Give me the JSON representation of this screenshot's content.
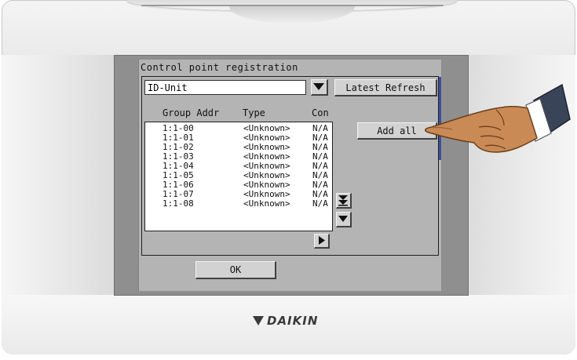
{
  "dialog": {
    "title": "Control point registration",
    "combo_value": "ID-Unit",
    "latest_refresh_label": "Latest Refresh",
    "add_all_label": "Add all",
    "ok_label": "OK",
    "columns": [
      "Group Addr",
      "Type",
      "Con"
    ],
    "rows": [
      {
        "addr": "1:1-00",
        "type": "<Unknown>",
        "con": "N/A"
      },
      {
        "addr": "1:1-01",
        "type": "<Unknown>",
        "con": "N/A"
      },
      {
        "addr": "1:1-02",
        "type": "<Unknown>",
        "con": "N/A"
      },
      {
        "addr": "1:1-03",
        "type": "<Unknown>",
        "con": "N/A"
      },
      {
        "addr": "1:1-04",
        "type": "<Unknown>",
        "con": "N/A"
      },
      {
        "addr": "1:1-05",
        "type": "<Unknown>",
        "con": "N/A"
      },
      {
        "addr": "1:1-06",
        "type": "<Unknown>",
        "con": "N/A"
      },
      {
        "addr": "1:1-07",
        "type": "<Unknown>",
        "con": "N/A"
      },
      {
        "addr": "1:1-08",
        "type": "<Unknown>",
        "con": "N/A"
      }
    ]
  },
  "device": {
    "brand": "DAIKIN"
  },
  "icons": {
    "combo_dropdown": "triangle-down-icon",
    "scroll_to_end": "double-triangle-down-icon",
    "scroll_down": "triangle-down-icon",
    "scroll_right": "triangle-right-icon",
    "pointer": "pointing-hand-icon"
  },
  "colors": {
    "screen_bg": "#b4b4b4",
    "list_bg": "#ffffff",
    "button_bg": "#d2d2d2",
    "accent_line": "#3e4e9a"
  }
}
